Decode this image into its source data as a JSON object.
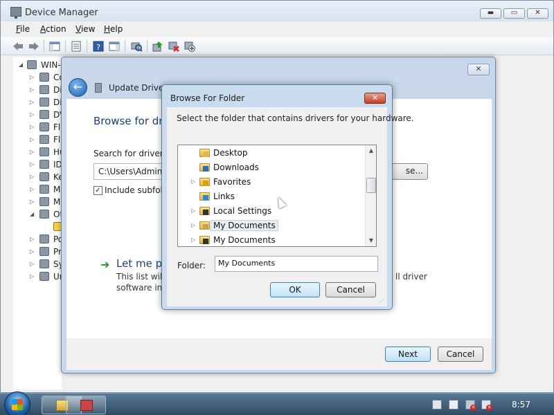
{
  "device_manager": {
    "title": "Device Manager",
    "caption_buttons": {
      "minimize": "▬",
      "maximize": "▭",
      "close": "✕"
    },
    "menu": [
      {
        "label": "File",
        "hotkey": "F"
      },
      {
        "label": "Action",
        "hotkey": "A"
      },
      {
        "label": "View",
        "hotkey": "V"
      },
      {
        "label": "Help",
        "hotkey": "H"
      }
    ],
    "toolbar_icons": [
      "back-arrow-icon",
      "forward-arrow-icon",
      "show-hide-console-tree-icon",
      "properties-icon",
      "help-icon",
      "action-pane-icon",
      "scan-hardware-icon",
      "update-driver-icon",
      "uninstall-icon",
      "disable-device-icon"
    ],
    "tree": {
      "root_label": "WIN-",
      "items": [
        {
          "label": "Co",
          "icon": "computer-icon"
        },
        {
          "label": "Di",
          "icon": "disk-drive-icon"
        },
        {
          "label": "Di",
          "icon": "display-adapter-icon"
        },
        {
          "label": "DV",
          "icon": "dvd-drive-icon"
        },
        {
          "label": "Fl",
          "icon": "floppy-controller-icon"
        },
        {
          "label": "Fl",
          "icon": "floppy-drive-icon"
        },
        {
          "label": "Hu",
          "icon": "hid-icon"
        },
        {
          "label": "ID",
          "icon": "ide-controller-icon"
        },
        {
          "label": "Ke",
          "icon": "keyboard-icon"
        },
        {
          "label": "Mi",
          "icon": "mouse-icon"
        },
        {
          "label": "M",
          "icon": "monitor-icon"
        },
        {
          "label": "Ot",
          "icon": "other-devices-icon"
        },
        {
          "label": "",
          "icon": "unknown-device-warning-icon"
        },
        {
          "label": "Po",
          "icon": "ports-icon"
        },
        {
          "label": "Pr",
          "icon": "processor-icon"
        },
        {
          "label": "Sy",
          "icon": "system-devices-icon"
        },
        {
          "label": "Ur",
          "icon": "usb-controller-icon"
        }
      ]
    }
  },
  "update_driver": {
    "title": "Update Driver So",
    "close_glyph": "✕",
    "back_glyph": "←",
    "heading": "Browse for dri",
    "search_label": "Search for driver so",
    "path_value": "C:\\Users\\Adminis",
    "browse_button": "se...",
    "subfolder_label": "Include subfold",
    "subfolder_checked": true,
    "letme_title": "Let me pi",
    "letme_line1": "This list will s",
    "letme_line2": "software in t",
    "letme_right1": "ll driver",
    "letme_right2": "",
    "next_button": "Next",
    "cancel_button": "Cancel"
  },
  "browse_folder": {
    "title": "Browse For Folder",
    "close_glyph": "✕",
    "instruction": "Select the folder that contains drivers for your hardware.",
    "folders": [
      {
        "label": "Desktop",
        "expandable": false,
        "selected": false,
        "icon": "desktop-folder-icon"
      },
      {
        "label": "Downloads",
        "expandable": false,
        "selected": false,
        "icon": "downloads-folder-icon"
      },
      {
        "label": "Favorites",
        "expandable": true,
        "selected": false,
        "icon": "favorites-folder-icon"
      },
      {
        "label": "Links",
        "expandable": false,
        "selected": false,
        "icon": "links-folder-icon"
      },
      {
        "label": "Local Settings",
        "expandable": true,
        "selected": false,
        "icon": "shortcut-folder-icon"
      },
      {
        "label": "My Documents",
        "expandable": true,
        "selected": true,
        "icon": "documents-folder-icon"
      },
      {
        "label": "My Documents",
        "expandable": true,
        "selected": false,
        "icon": "shortcut-folder-icon"
      }
    ],
    "folder_label": "Folder:",
    "folder_value": "My Documents",
    "ok_button": "OK",
    "cancel_button": "Cancel",
    "expand_glyph": "▷",
    "scroll_up_glyph": "▲",
    "scroll_down_glyph": "▼",
    "grip_glyph": "⋰"
  },
  "taskbar": {
    "clock": "8:57",
    "tray_icons": [
      "action-center-icon",
      "network-icon",
      "power-icon",
      "volume-muted-icon"
    ]
  },
  "colors": {
    "accent_heading": "#1e3f78",
    "selection_fill": "#e8eef5",
    "close_red": "#c4402a",
    "default_button_border": "#3c7fb1"
  }
}
